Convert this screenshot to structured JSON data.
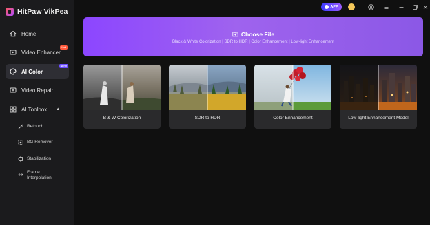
{
  "app": {
    "name": "HitPaw VikPea"
  },
  "sidebar": {
    "items": [
      {
        "label": "Home",
        "icon": "home-icon"
      },
      {
        "label": "Video Enhancer",
        "icon": "video-enhancer-icon",
        "badge": "Hot"
      },
      {
        "label": "AI Color",
        "icon": "ai-color-icon",
        "badge": "NEW",
        "active": true
      },
      {
        "label": "Video Repair",
        "icon": "video-repair-icon"
      },
      {
        "label": "AI Toolbox",
        "icon": "toolbox-icon",
        "expanded": true
      }
    ],
    "toolbox_items": [
      {
        "label": "Retouch",
        "icon": "retouch-icon"
      },
      {
        "label": "BG Remover",
        "icon": "bg-remover-icon"
      },
      {
        "label": "Stabilization",
        "icon": "stabilization-icon"
      },
      {
        "label": "Frame Interpolation",
        "icon": "frame-interpolation-icon"
      }
    ]
  },
  "titlebar": {
    "app_pill": "APP",
    "icons": [
      "coin-icon",
      "user-icon",
      "menu-icon",
      "minimize-icon",
      "restore-icon",
      "close-icon"
    ]
  },
  "hero": {
    "title": "Choose File",
    "subtitle": "Black & White Colorization | SDR to HDR | Color Enhancement | Low-light Enhancement"
  },
  "cards": [
    {
      "label": "B & W Colorization"
    },
    {
      "label": "SDR to HDR"
    },
    {
      "label": "Color Enhancement"
    },
    {
      "label": "Low-light Enhancement Model"
    }
  ],
  "colors": {
    "accent": "#8c46ff",
    "sidebar_bg": "#1b1b1d",
    "main_bg": "#101010",
    "card_bg": "#2a2a2c"
  }
}
